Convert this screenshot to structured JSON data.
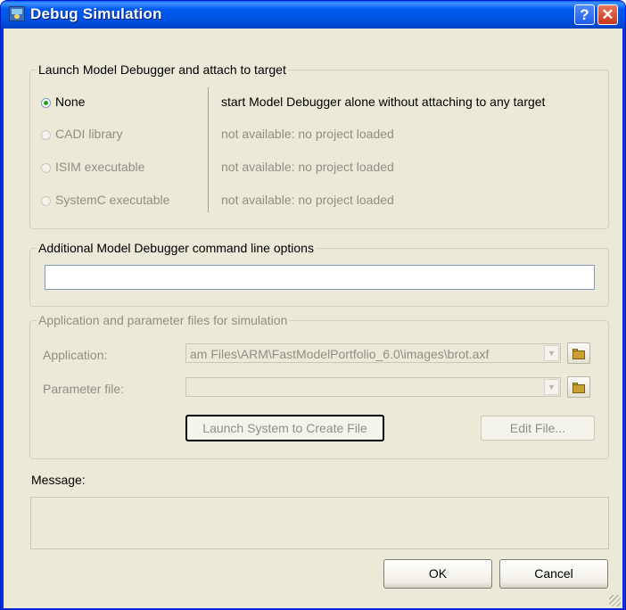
{
  "window": {
    "title": "Debug Simulation",
    "help_glyph": "?",
    "close_glyph": "✕"
  },
  "launch": {
    "legend": "Launch Model Debugger and attach to target",
    "options": [
      {
        "label": "None",
        "description": "start Model Debugger alone without attaching to any target",
        "checked": true,
        "enabled": true
      },
      {
        "label": "CADI library",
        "description": "not available: no project loaded",
        "checked": false,
        "enabled": false
      },
      {
        "label": "ISIM executable",
        "description": "not available: no project loaded",
        "checked": false,
        "enabled": false
      },
      {
        "label": "SystemC executable",
        "description": "not available: no project loaded",
        "checked": false,
        "enabled": false
      }
    ]
  },
  "options_group": {
    "legend": "Additional Model Debugger command line options",
    "value": ""
  },
  "app_group": {
    "legend": "Application and parameter files for simulation",
    "application_label": "Application:",
    "application_value": "am Files\\ARM\\FastModelPortfolio_6.0\\images\\brot.axf",
    "parameter_label": "Parameter file:",
    "parameter_value": "",
    "launch_button": "Launch System to Create File",
    "edit_button": "Edit File..."
  },
  "message": {
    "label": "Message:",
    "text": ""
  },
  "buttons": {
    "ok": "OK",
    "cancel": "Cancel"
  },
  "icons": {
    "app": "app-window-icon",
    "help": "help-icon",
    "close": "close-icon",
    "browse": "folder-open-icon",
    "dropdown": "chevron-down-icon"
  },
  "colors": {
    "title_bar": "#0058ee",
    "dialog_bg": "#ece9d8",
    "close_button": "#c8361b",
    "disabled_text": "#8f8f85"
  }
}
